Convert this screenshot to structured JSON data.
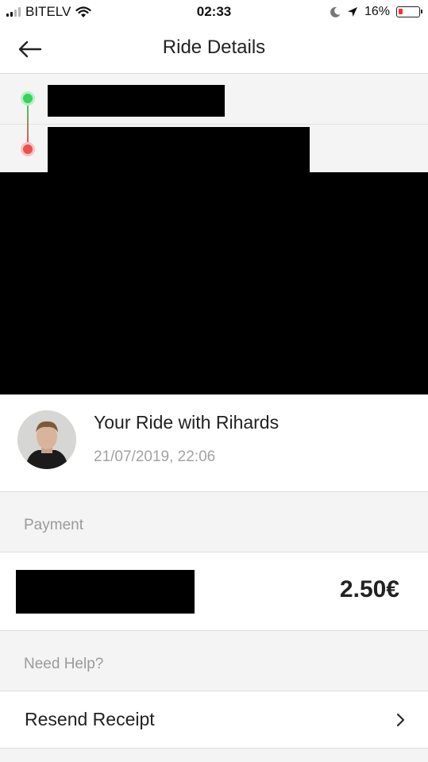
{
  "status_bar": {
    "carrier": "BITELV",
    "time": "02:33",
    "battery": "16%",
    "icons": [
      "signal-icon",
      "wifi-icon",
      "moon-icon",
      "location-arrow-icon",
      "battery-icon"
    ]
  },
  "header": {
    "title": "Ride Details",
    "back_icon": "back-arrow-icon"
  },
  "route": {
    "start_icon": "pickup-dot-icon",
    "end_icon": "dropoff-dot-icon",
    "start_address": "",
    "end_address": ""
  },
  "driver": {
    "title": "Your Ride with Rihards",
    "datetime": "21/07/2019, 22:06"
  },
  "payment": {
    "section_label": "Payment",
    "method": "",
    "amount": "2.50€"
  },
  "help": {
    "section_label": "Need Help?",
    "resend_label": "Resend Receipt",
    "chevron_icon": "chevron-right-icon"
  },
  "colors": {
    "start": "#39d15a",
    "end": "#ee5050",
    "section_bg": "#f4f4f5",
    "muted_text": "#9a9a9a"
  }
}
